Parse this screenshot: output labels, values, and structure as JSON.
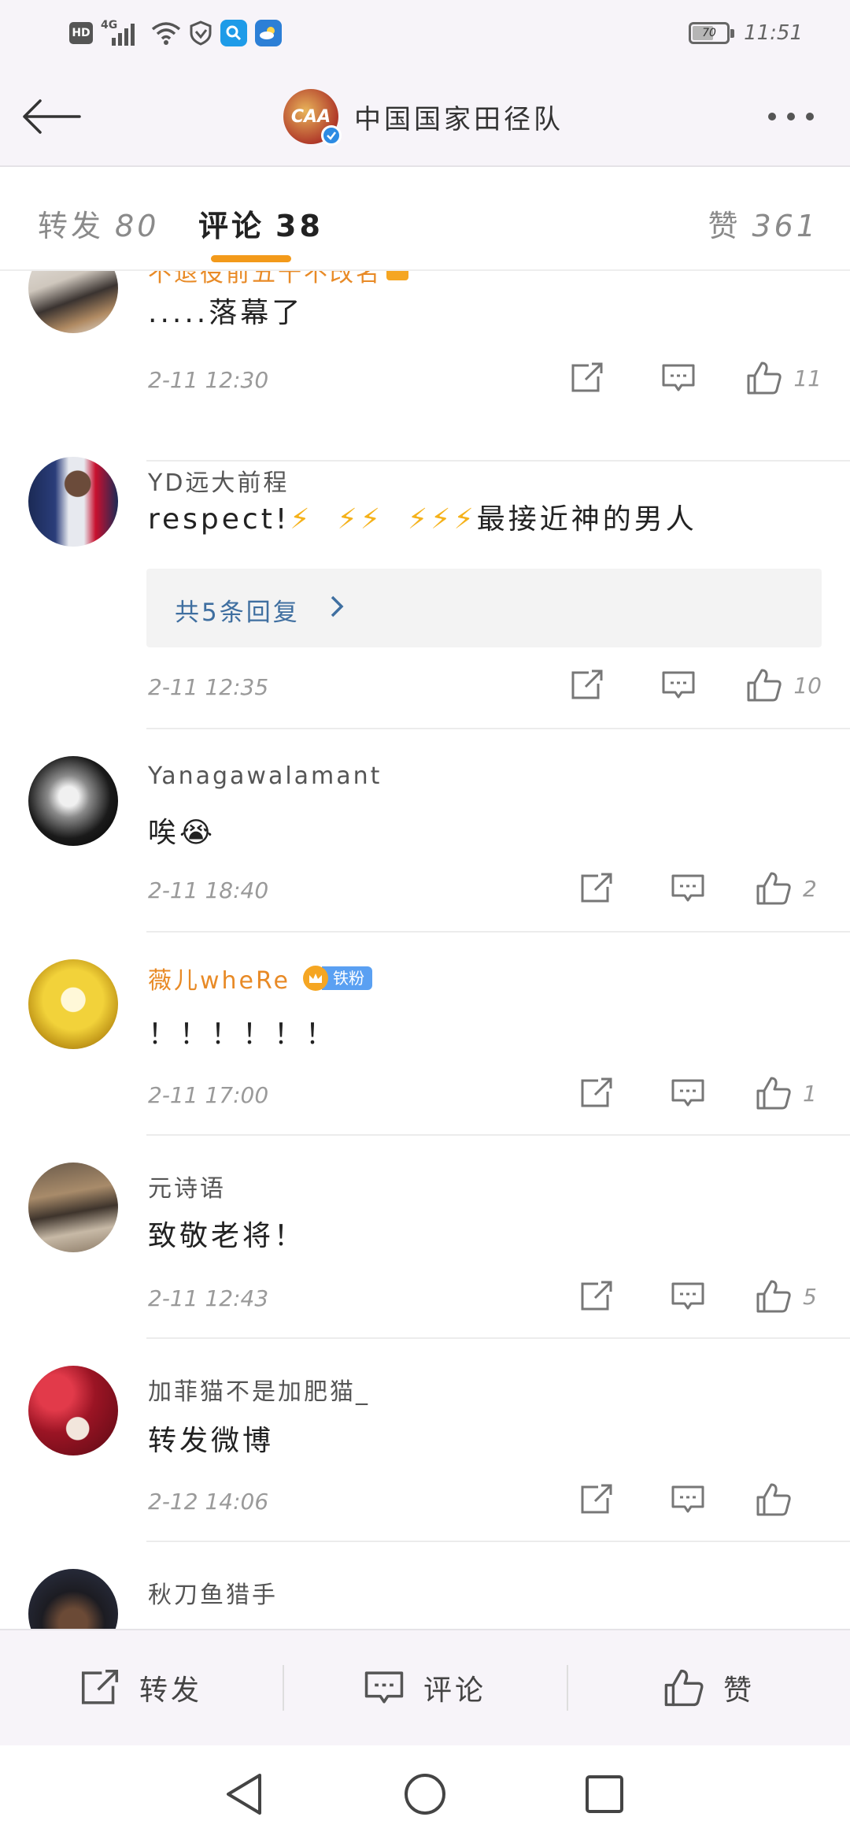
{
  "status_bar": {
    "hd": "HD",
    "network": "4G",
    "battery": "70",
    "time": "11:51",
    "icons": [
      "hd-icon",
      "signal-icon",
      "wifi-icon",
      "vpn-shield-icon",
      "search-app-icon",
      "weather-app-icon",
      "battery-icon"
    ]
  },
  "header": {
    "title": "中国国家田径队",
    "avatar_text": "CAA",
    "icons": [
      "back-arrow-icon",
      "verified-icon",
      "more-dots-icon"
    ]
  },
  "tabs": {
    "repost_label": "转发",
    "repost_count": "80",
    "comment_label": "评论",
    "comment_count": "38",
    "like_label": "赞",
    "like_count": "361",
    "active": "comment",
    "accent_color": "#f39a1a"
  },
  "comments": [
    {
      "name": "不退役前五十不改名",
      "text": ".....落幕了",
      "time": "2-11 12:30",
      "likes": "11"
    },
    {
      "name": "YD远大前程",
      "text_prefix": "respect!",
      "bolts": [
        "⚡",
        "⚡⚡",
        "⚡⚡⚡"
      ],
      "text_suffix": "最接近神的男人",
      "replies": "共5条回复",
      "time": "2-11 12:35",
      "likes": "10"
    },
    {
      "name": "Yanagawalamant",
      "text": "唉😭",
      "time": "2-11 18:40",
      "likes": "2"
    },
    {
      "name": "薇儿wheRe",
      "fan_badge": "铁粉",
      "text": "！！！！！！",
      "time": "2-11 17:00",
      "likes": "1"
    },
    {
      "name": "元诗语",
      "text": "致敬老将！",
      "time": "2-11 12:43",
      "likes": "5"
    },
    {
      "name": "加菲猫不是加肥猫_",
      "text": "转发微博",
      "time": "2-12 14:06",
      "likes": ""
    },
    {
      "name": "秋刀鱼猎手"
    }
  ],
  "bottom_bar": {
    "repost": "转发",
    "comment": "评论",
    "like": "赞"
  },
  "colors": {
    "orange_name": "#e88a26",
    "reply_link": "#3f6fa0",
    "verified_blue": "#2d8be3",
    "verified_orange": "#f5a623",
    "fan_badge_blue": "#5aa0f2"
  }
}
